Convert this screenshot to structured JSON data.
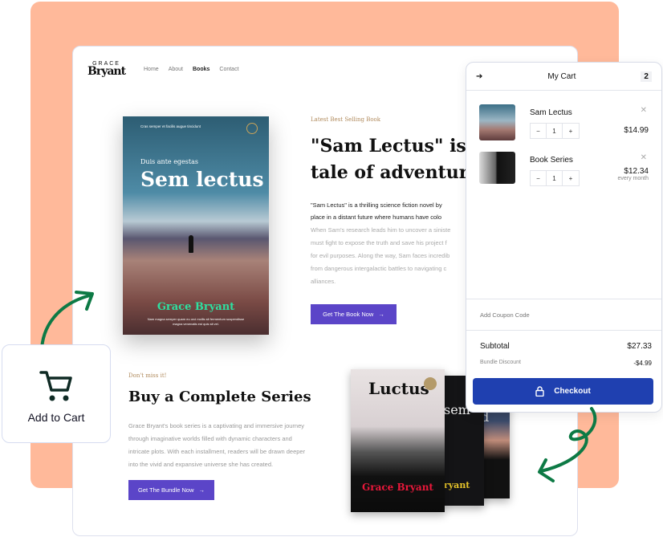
{
  "brand": {
    "small": "GRACE",
    "large": "Bryant"
  },
  "nav": [
    {
      "label": "Home"
    },
    {
      "label": "About"
    },
    {
      "label": "Books",
      "active": true
    },
    {
      "label": "Contact"
    }
  ],
  "hero": {
    "cover": {
      "tagline": "Cras semper et facilis augue tincidunt",
      "subtitle": "Duis ante egestas",
      "title": "Sem lectus",
      "author": "Grace Bryant",
      "blurb": "Nam magna semper quam eu orci mollis sit fermentum suspendisse magna venenatis est quis sit vel."
    },
    "eyebrow": "Latest Best Selling Book",
    "title_lines": [
      "\"Sam Lectus\" is a",
      "tale of adventure,"
    ],
    "lead_lines": [
      "\"Sam Lectus\" is a thrilling science fiction novel by",
      "place in a distant future where humans have colo"
    ],
    "body_lines": [
      "When Sam's research leads him to uncover a siniste",
      "must fight to expose the truth and save his project f",
      "for evil purposes. Along the way, Sam faces incredib",
      "from dangerous intergalactic battles to navigating c",
      "alliances."
    ],
    "cta": "Get The Book Now"
  },
  "series": {
    "eyebrow": "Don't miss it!",
    "title": "Buy a Complete Series",
    "body_lines": [
      "Grace Bryant's book series is a captivating and immersive journey",
      "through imaginative worlds filled with dynamic characters and",
      "intricate plots. With each installment, readers will be drawn deeper",
      "into the vivid and expansive universe she has created."
    ],
    "cta": "Get The Bundle Now",
    "books": [
      {
        "title": "Luctus",
        "author": "Grace Bryant"
      },
      {
        "title": "sem",
        "author": "ryant"
      },
      {
        "title": "d",
        "author": "t"
      }
    ]
  },
  "cart": {
    "title": "My Cart",
    "count": "2",
    "items": [
      {
        "name": "Sam Lectus",
        "qty": "1",
        "price": "$14.99"
      },
      {
        "name": "Book Series",
        "qty": "1",
        "price": "$12.34",
        "note": "every month"
      }
    ],
    "coupon_label": "Add Coupon Code",
    "subtotal_label": "Subtotal",
    "subtotal": "$27.33",
    "discount_label": "Bundle Discount",
    "discount": "-$4.99",
    "checkout": "Checkout"
  },
  "add_to_cart": {
    "label": "Add to Cart"
  },
  "colors": {
    "peach": "#FFB99A",
    "button": "#5b45c8",
    "checkout": "#1f40b0",
    "arrow": "#0d7a45"
  }
}
